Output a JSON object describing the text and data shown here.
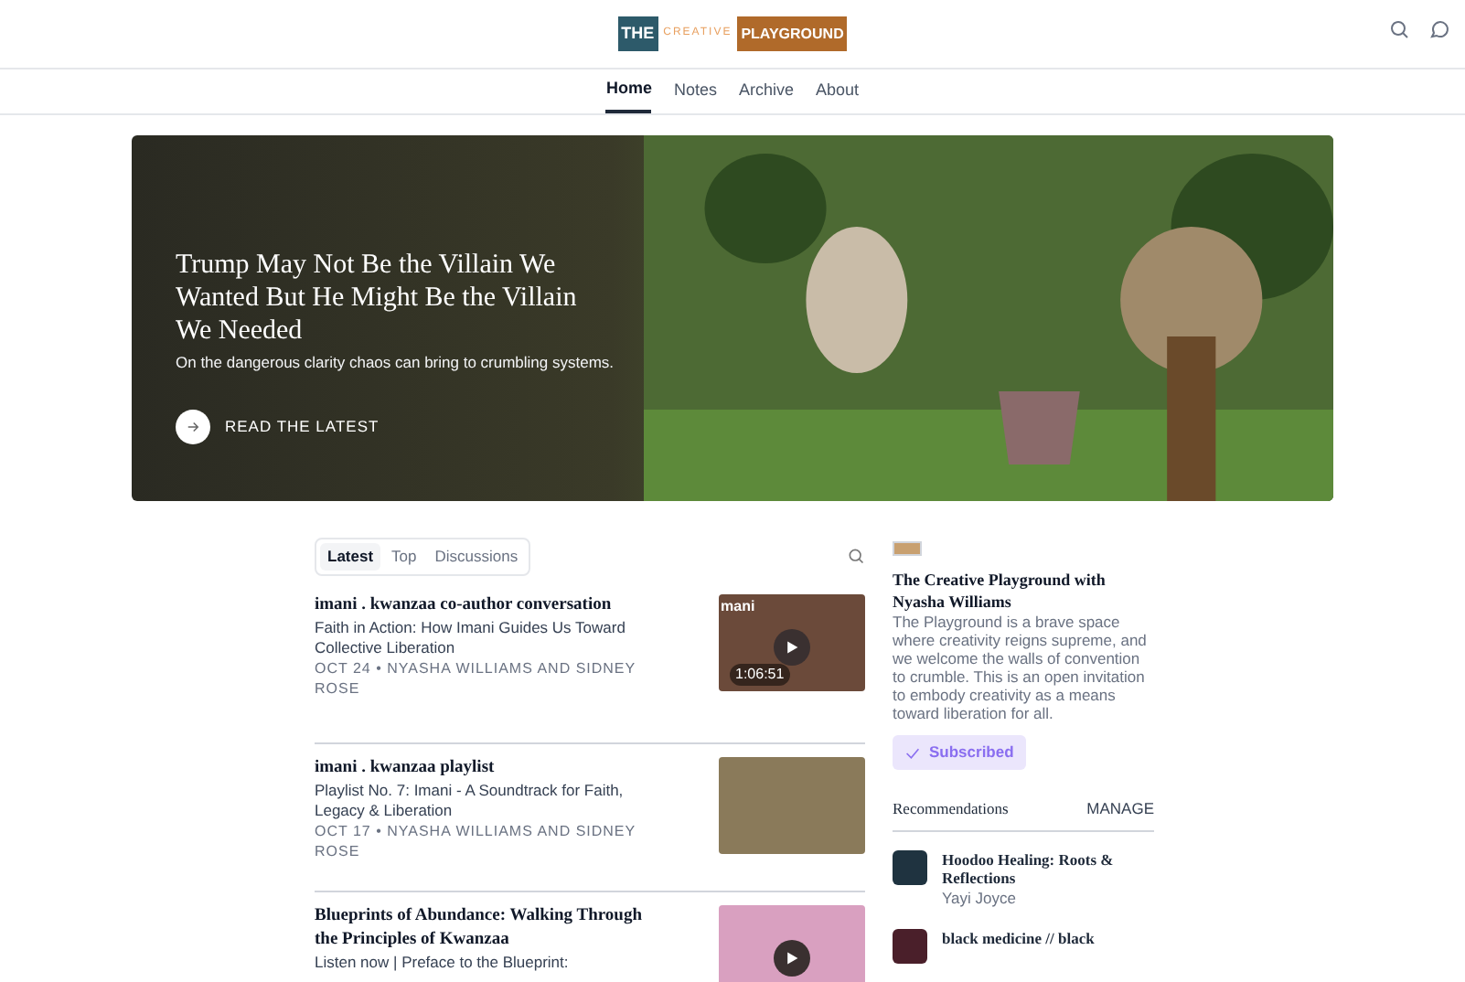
{
  "header": {
    "logo": {
      "word_1": "THE",
      "word_2": "CREATIVE",
      "word_3": "PLAYGROUND"
    }
  },
  "nav": [
    {
      "label": "Home",
      "selected": true
    },
    {
      "label": "Notes",
      "selected": false
    },
    {
      "label": "Archive",
      "selected": false
    },
    {
      "label": "About",
      "selected": false
    }
  ],
  "hero": {
    "title": "Trump May Not Be the Villain We Wanted But He Might Be the Villain We Needed",
    "subtitle": "On the dangerous clarity chaos can bring to crumbling systems.",
    "cta": "READ THE LATEST"
  },
  "feed_tabs": [
    {
      "label": "Latest",
      "selected": true
    },
    {
      "label": "Top",
      "selected": false
    },
    {
      "label": "Discussions",
      "selected": false
    }
  ],
  "posts": [
    {
      "title": "imani . kwanzaa co-author conversation",
      "subtitle": "Faith in Action: How Imani Guides Us Toward Collective Liberation",
      "meta": "OCT 24 • NYASHA WILLIAMS AND SIDNEY ROSE",
      "thumb_label": "mani",
      "duration": "1:06:51"
    },
    {
      "title": "imani . kwanzaa playlist",
      "subtitle": "Playlist No. 7: Imani - A Soundtrack for Faith, Legacy & Liberation",
      "meta": "OCT 17 • NYASHA WILLIAMS AND SIDNEY ROSE"
    },
    {
      "title": "Blueprints of Abundance: Walking Through the Principles of Kwanzaa",
      "subtitle": "Listen now | Preface to the Blueprint:"
    }
  ],
  "sidebar": {
    "title": "The Creative Playground with Nyasha Williams",
    "description": "The Playground is a brave space where creativity reigns supreme, and we welcome the walls of convention to crumble. This is an open invitation to embody creativity as a means toward liberation for all.",
    "subscribe": {
      "label": "Subscribed",
      "checked": true
    },
    "recommendations_title": "Recommendations",
    "manage": "MANAGE",
    "recommendations": [
      {
        "name": "Hoodoo Healing: Roots & Reflections",
        "author": "Yayi Joyce",
        "color": "#1f3340"
      },
      {
        "name": "black medicine // black",
        "color": "#4a1f2a"
      }
    ]
  }
}
